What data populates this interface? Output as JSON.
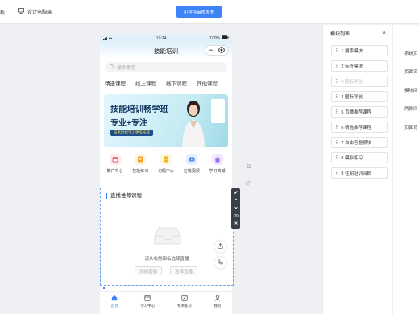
{
  "topbar": {
    "left_fragment": "板",
    "desktop_label": "设计电脑端",
    "publish_label": "小程序审核发布"
  },
  "phone": {
    "status": {
      "time": "10:24",
      "battery": "100%"
    },
    "title": "技能培训",
    "capsule": {
      "more": "•••"
    },
    "search_placeholder": "搜索课程",
    "tabs": [
      "精选课程",
      "线上课程",
      "线下课程",
      "其他课程"
    ],
    "banner": {
      "line1": "技能培训畅学班",
      "line2": "专业+专注",
      "pill": "技术轻松学习更多技能"
    },
    "icons": [
      {
        "label": "推广中心",
        "icon": "calendar-icon",
        "color": "#ef5a6f",
        "bg": "#fde8ec"
      },
      {
        "label": "技能练习",
        "icon": "book-icon",
        "color": "#f3a422",
        "bg": "#fef2dc"
      },
      {
        "label": "习题中心",
        "icon": "doc-icon",
        "color": "#f2b21d",
        "bg": "#fef6dc"
      },
      {
        "label": "在线视频",
        "icon": "video-icon",
        "color": "#4a8ef6",
        "bg": "#e4efff"
      },
      {
        "label": "学习商城",
        "icon": "shop-icon",
        "color": "#9a6ef0",
        "bg": "#efe8fe"
      }
    ],
    "module": {
      "title": "直播推荐课程",
      "hint": "请从右侧面板选择直播",
      "btn_add": "添加直播",
      "btn_select": "选择直播"
    },
    "tabbar": [
      {
        "label": "首页",
        "icon": "home-icon"
      },
      {
        "label": "学习中心",
        "icon": "calendar-icon"
      },
      {
        "label": "专项练习",
        "icon": "edit-icon"
      },
      {
        "label": "我的",
        "icon": "user-icon"
      }
    ]
  },
  "panel": {
    "header": "模块列表",
    "items": [
      {
        "label": "1 搜索模块",
        "disabled": false
      },
      {
        "label": "2 标签模块",
        "disabled": false
      },
      {
        "label": "3 图标导航",
        "disabled": true
      },
      {
        "label": "4 图标导航",
        "disabled": false
      },
      {
        "label": "5 直播推荐课程",
        "disabled": false
      },
      {
        "label": "6 精选推荐课程",
        "disabled": false
      },
      {
        "label": "7 自由容器模块",
        "disabled": false
      },
      {
        "label": "8 模拟练习",
        "disabled": false
      },
      {
        "label": "9 往期培训回顾",
        "disabled": false
      }
    ],
    "right_items": [
      "系统页",
      "页面名",
      "模块间",
      "两侧间",
      "页面背"
    ]
  },
  "colors": {
    "accent": "#3e84f7"
  }
}
